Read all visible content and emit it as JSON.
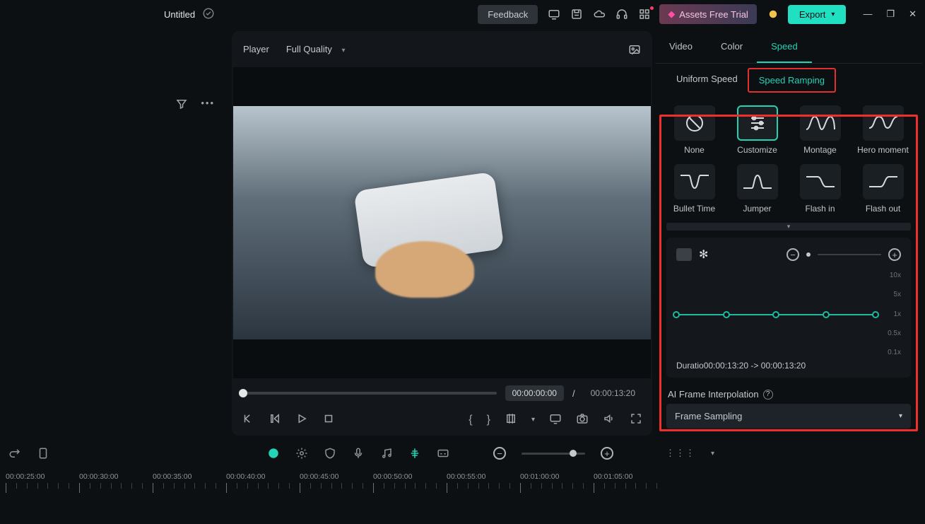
{
  "titlebar": {
    "title": "Untitled",
    "feedback": "Feedback",
    "trial": "Assets Free Trial",
    "export": "Export"
  },
  "player": {
    "label": "Player",
    "quality": "Full Quality",
    "current": "00:00:00:00",
    "sep": "/",
    "total": "00:00:13:20"
  },
  "right": {
    "tabs": [
      "Video",
      "Color",
      "Speed"
    ],
    "activeTab": "Speed",
    "subtabs": [
      "Uniform Speed",
      "Speed Ramping"
    ],
    "activeSubtab": "Speed Ramping",
    "presets": [
      {
        "id": "none",
        "label": "None"
      },
      {
        "id": "customize",
        "label": "Customize",
        "active": true
      },
      {
        "id": "montage",
        "label": "Montage"
      },
      {
        "id": "hero",
        "label": "Hero moment"
      },
      {
        "id": "bullet",
        "label": "Bullet Time"
      },
      {
        "id": "jumper",
        "label": "Jumper"
      },
      {
        "id": "flashin",
        "label": "Flash in"
      },
      {
        "id": "flashout",
        "label": "Flash out"
      }
    ],
    "yticks": [
      "10x",
      "5x",
      "1x",
      "0.5x",
      "0.1x"
    ],
    "durationLabel": "Duratio",
    "durationFrom": "00:00:13:20",
    "durationArrow": " -> ",
    "durationTo": "00:00:13:20",
    "aiLabel": "AI Frame Interpolation",
    "aiSelect": "Frame Sampling"
  },
  "timeline": {
    "marks": [
      "00:00:25:00",
      "00:00:30:00",
      "00:00:35:00",
      "00:00:40:00",
      "00:00:45:00",
      "00:00:50:00",
      "00:00:55:00",
      "00:01:00:00",
      "00:01:05:00"
    ]
  }
}
